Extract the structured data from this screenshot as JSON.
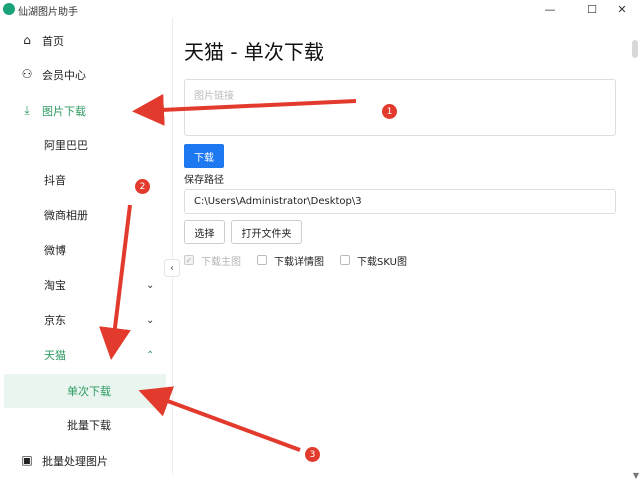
{
  "window": {
    "title": "仙湖图片助手",
    "minimize": "—",
    "maximize": "☐",
    "close": "✕"
  },
  "sidebar": {
    "items": [
      {
        "label": "首页",
        "icon": "home-icon",
        "glyph": "⌂"
      },
      {
        "label": "会员中心",
        "icon": "user-add-icon",
        "glyph": "⚇"
      },
      {
        "label": "图片下载",
        "icon": "download-icon",
        "glyph": "⤓"
      },
      {
        "label": "阿里巴巴"
      },
      {
        "label": "抖音"
      },
      {
        "label": "微商相册"
      },
      {
        "label": "微博"
      },
      {
        "label": "淘宝",
        "chevron": "⌄"
      },
      {
        "label": "京东",
        "chevron": "⌄"
      },
      {
        "label": "天猫",
        "chevron": "⌃"
      },
      {
        "label": "单次下载"
      },
      {
        "label": "批量下载"
      },
      {
        "label": "批量处理图片",
        "icon": "image-icon",
        "glyph": "▣"
      }
    ],
    "collapse": "‹"
  },
  "main": {
    "title": "天猫 - 单次下载",
    "url_placeholder": "图片链接",
    "download_button": "下载",
    "save_path_label": "保存路径",
    "save_path_value": "C:\\Users\\Administrator\\Desktop\\3",
    "choose_button": "选择",
    "open_folder_button": "打开文件夹",
    "options": [
      {
        "label": "下载主图",
        "checked": true,
        "disabled": true
      },
      {
        "label": "下载详情图",
        "checked": false,
        "disabled": false
      },
      {
        "label": "下载SKU图",
        "checked": false,
        "disabled": false
      }
    ]
  },
  "annotations": {
    "badges": [
      "1",
      "2",
      "3"
    ],
    "color": "#e23b2e"
  },
  "colors": {
    "accent": "#2e9b62",
    "primary_button": "#1e78f0"
  }
}
